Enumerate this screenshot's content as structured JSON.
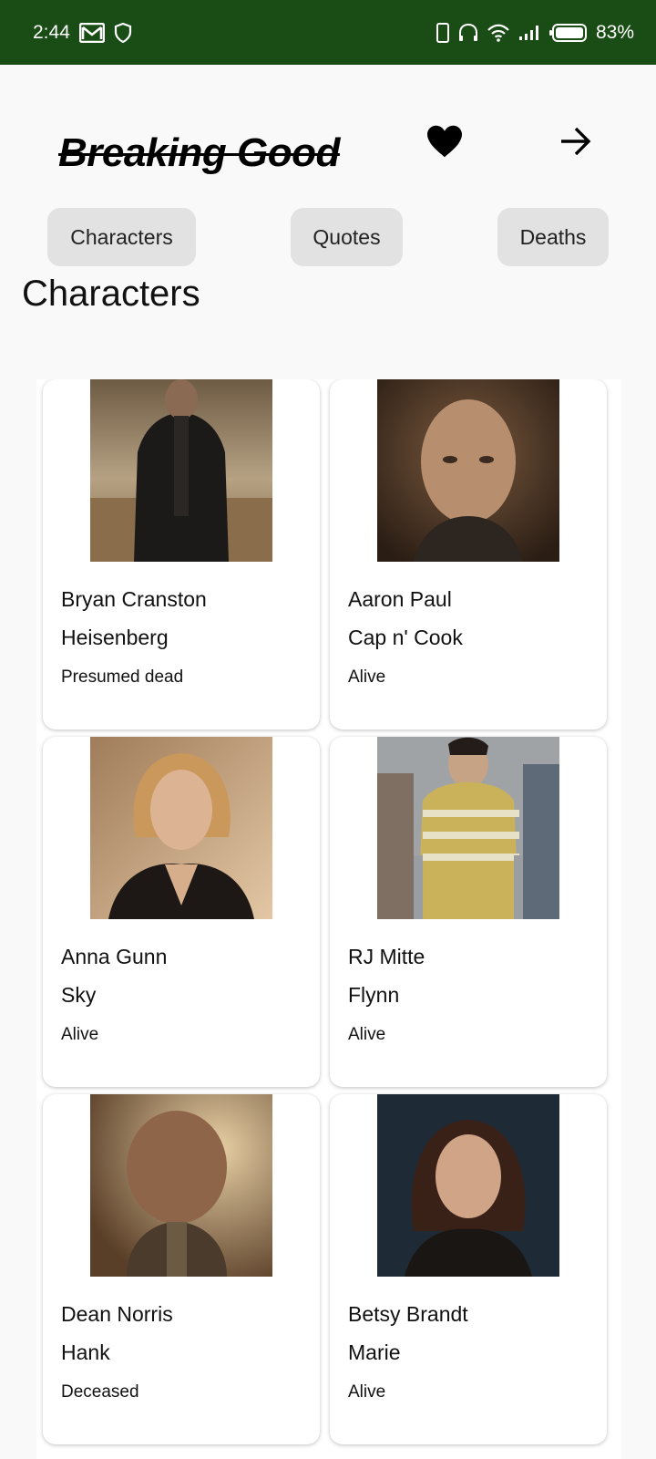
{
  "status_bar": {
    "time": "2:44",
    "battery": "83%",
    "left_icons": [
      "gmail-icon",
      "shield-icon"
    ],
    "right_icons": [
      "vibrate-icon",
      "headphones-icon",
      "wifi-icon",
      "signal-icon",
      "battery-icon"
    ],
    "background": "#1a4d16"
  },
  "header": {
    "title": "Breaking Good",
    "favorite_icon": "heart-icon",
    "next_icon": "arrow-right-icon"
  },
  "tabs": [
    {
      "label": "Characters"
    },
    {
      "label": "Quotes"
    },
    {
      "label": "Deaths"
    }
  ],
  "section": {
    "title": "Characters"
  },
  "characters": [
    {
      "name": "Bryan Cranston",
      "nickname": "Heisenberg",
      "status": "Presumed dead"
    },
    {
      "name": "Aaron Paul",
      "nickname": "Cap n' Cook",
      "status": "Alive"
    },
    {
      "name": "Anna Gunn",
      "nickname": "Sky",
      "status": "Alive"
    },
    {
      "name": "RJ Mitte",
      "nickname": "Flynn",
      "status": "Alive"
    },
    {
      "name": "Dean Norris",
      "nickname": "Hank",
      "status": "Deceased"
    },
    {
      "name": "Betsy Brandt",
      "nickname": "Marie",
      "status": "Alive"
    }
  ]
}
